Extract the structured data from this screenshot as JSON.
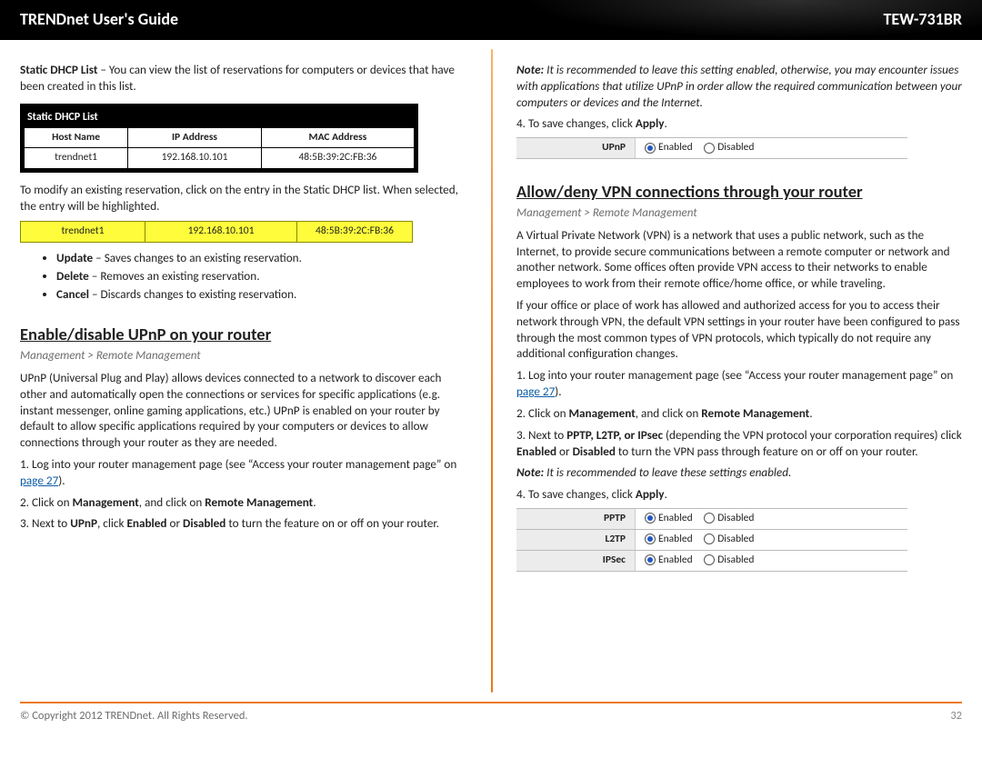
{
  "header": {
    "title_left": "TRENDnet User's Guide",
    "title_right": "TEW-731BR"
  },
  "left": {
    "static_dhcp_intro_bold": "Static DHCP List",
    "static_dhcp_intro_rest": " – You can view the list of reservations for computers or devices that have been created in this list.",
    "dhcp_table": {
      "title": "Static DHCP List",
      "headers": [
        "Host Name",
        "IP Address",
        "MAC Address"
      ],
      "row": [
        "trendnet1",
        "192.168.10.101",
        "48:5B:39:2C:FB:36"
      ]
    },
    "modify_text": "To modify an existing reservation, click on the entry in the Static DHCP list. When selected, the entry will be highlighted.",
    "hl_row": [
      "trendnet1",
      "192.168.10.101",
      "48:5B:39:2C:FB:36"
    ],
    "bullets": [
      {
        "b": "Update",
        "t": " – Saves changes to an existing reservation."
      },
      {
        "b": "Delete",
        "t": " – Removes an existing reservation."
      },
      {
        "b": "Cancel",
        "t": " – Discards changes to existing reservation."
      }
    ],
    "upnp_heading": "Enable/disable UPnP on your router",
    "upnp_breadcrumb": "Management > Remote Management",
    "upnp_desc": "UPnP (Universal Plug and Play) allows devices connected to a network to discover each other and automatically open the connections or services for specific applications (e.g. instant messenger, online gaming applications, etc.) UPnP is enabled on your router by default to allow specific applications required by your computers or devices to allow connections through your router as they are needed.",
    "step1a": "1. Log into your router management page (see “Access your router management page” on ",
    "step1_link": "page 27",
    "step1b": ").",
    "step2_pre": "2. Click on ",
    "step2_b1": "Management",
    "step2_mid": ", and click on ",
    "step2_b2": "Remote Management",
    "step2_post": ".",
    "step3_pre": "3. Next to ",
    "step3_b1": "UPnP",
    "step3_mid1": ", click ",
    "step3_b2": "Enabled",
    "step3_mid2": " or ",
    "step3_b3": "Disabled",
    "step3_post": " to turn the feature on or off on your router."
  },
  "right": {
    "note_bold": "Note:",
    "note_text": " It is recommended to leave this setting enabled, otherwise, you may encounter issues with applications that utilize UPnP in order allow the required communication between your computers or devices and the Internet.",
    "save_pre": "4. To save changes, click ",
    "save_b": "Apply",
    "save_post": ".",
    "upnp_row": {
      "label": "UPnP",
      "enabled": "Enabled",
      "disabled": "Disabled"
    },
    "vpn_heading": "Allow/deny VPN connections through your router",
    "vpn_breadcrumb": "Management > Remote Management",
    "vpn_p1": "A Virtual Private Network (VPN) is a network that uses a public network, such as the Internet, to provide secure communications between a remote computer or network and another network. Some offices often provide VPN access to their networks to enable employees to work from their remote office/home office, or while traveling.",
    "vpn_p2": "If your office or place of work has allowed and authorized access for you to access their network through VPN, the default VPN settings in your router have been configured to pass through the most common types of VPN protocols, which typically do not require any additional configuration changes.",
    "vpn_step1a": "1. Log into your router management page (see “Access your router management page” on ",
    "vpn_step1_link": "page 27",
    "vpn_step1b": ").",
    "vpn_step2_pre": "2. Click on ",
    "vpn_step2_b1": "Management",
    "vpn_step2_mid": ", and click on ",
    "vpn_step2_b2": "Remote Management",
    "vpn_step2_post": ".",
    "vpn_step3_pre": "3. Next to ",
    "vpn_step3_b1": "PPTP, L2TP, or IPsec",
    "vpn_step3_mid1": " (depending the VPN protocol your corporation requires) click ",
    "vpn_step3_b2": "Enabled",
    "vpn_step3_mid2": " or ",
    "vpn_step3_b3": "Disabled",
    "vpn_step3_post": " to turn the VPN pass through feature on or off on your router.",
    "vpn_note_bold": "Note:",
    "vpn_note_text": " It is recommended to leave these settings enabled.",
    "vpn_save_pre": "4. To save changes, click ",
    "vpn_save_b": "Apply",
    "vpn_save_post": ".",
    "vpn_rows": [
      {
        "label": "PPTP",
        "enabled": "Enabled",
        "disabled": "Disabled"
      },
      {
        "label": "L2TP",
        "enabled": "Enabled",
        "disabled": "Disabled"
      },
      {
        "label": "IPSec",
        "enabled": "Enabled",
        "disabled": "Disabled"
      }
    ]
  },
  "footer": {
    "copyright": "© Copyright 2012 TRENDnet. All Rights Reserved.",
    "page": "32"
  }
}
